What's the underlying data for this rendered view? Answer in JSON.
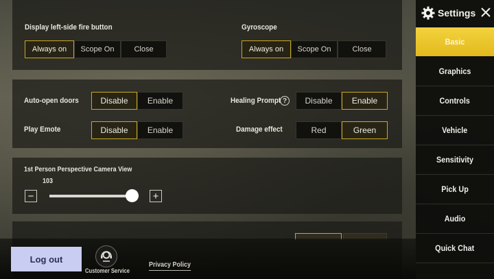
{
  "panel_top": {
    "fire_button": {
      "label": "Display left-side fire button",
      "options": [
        "Always on",
        "Scope On",
        "Close"
      ],
      "selected": "Always on"
    },
    "gyroscope": {
      "label": "Gyroscope",
      "options": [
        "Always on",
        "Scope On",
        "Close"
      ],
      "selected": "Always on"
    }
  },
  "panel_mid": {
    "auto_open_doors": {
      "label": "Auto-open doors",
      "options": [
        "Disable",
        "Enable"
      ],
      "selected": "Disable"
    },
    "healing_prompt": {
      "label": "Healing Prompt",
      "help_glyph": "?",
      "options": [
        "Disable",
        "Enable"
      ],
      "selected": "Enable"
    },
    "play_emote": {
      "label": "Play Emote",
      "options": [
        "Disable",
        "Enable"
      ],
      "selected": "Disable"
    },
    "damage_effect": {
      "label": "Damage effect",
      "options": [
        "Red",
        "Green"
      ],
      "selected": "Green"
    }
  },
  "camera": {
    "label": "1st Person Perspective Camera View",
    "value": "103",
    "slider_fraction": 0.93,
    "minus": "−",
    "plus": "+"
  },
  "sidebar": {
    "title": "Settings",
    "tabs": [
      "Basic",
      "Graphics",
      "Controls",
      "Vehicle",
      "Sensitivity",
      "Pick Up",
      "Audio",
      "Quick Chat"
    ],
    "active_tab": "Basic"
  },
  "bottom": {
    "logout": "Log out",
    "customer_service": "Customer Service",
    "privacy_policy": "Privacy Policy"
  },
  "colors": {
    "accent": "#e2ba1c",
    "selected_border": "#c8a82a",
    "logout_bg": "#c9cdf2"
  }
}
